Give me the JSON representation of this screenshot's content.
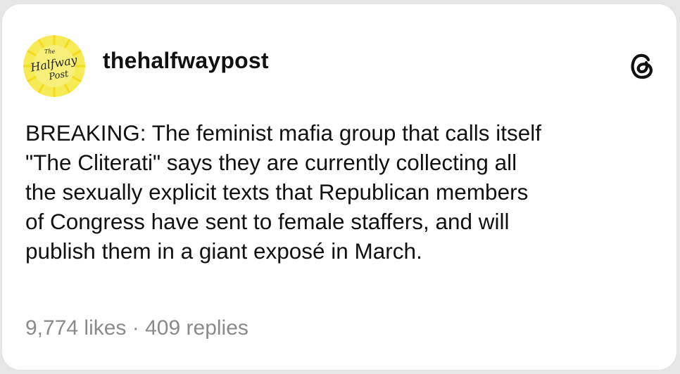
{
  "post": {
    "avatar_text_top": "The",
    "avatar_text_main": "Halfway",
    "avatar_text_bottom": "Post",
    "username": "thehalfwaypost",
    "app_icon": "threads-logo-icon",
    "body": "BREAKING: The feminist mafia group that calls itself\n\"The Cliterati\" says they are currently collecting all\nthe sexually explicit texts that Republican members\nof Congress have sent to female staffers, and will\npublish them in a giant exposé in March.",
    "likes": "9,774 likes",
    "separator": "·",
    "replies": "409 replies"
  },
  "colors": {
    "avatar_bg": "#f4e64a",
    "avatar_ring": "#f0d820",
    "text": "#111111",
    "muted": "#8a8a8a"
  }
}
